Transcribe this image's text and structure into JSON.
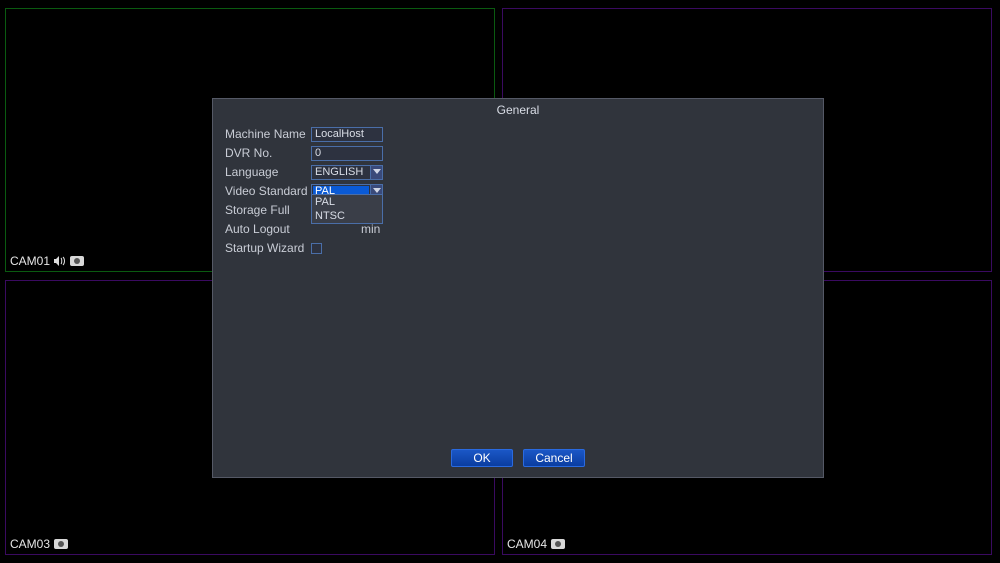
{
  "cameras": {
    "tl": {
      "label": "CAM01",
      "audio": true,
      "rec": true,
      "selected": true
    },
    "tr": {
      "label": "",
      "audio": false,
      "rec": false
    },
    "bl": {
      "label": "CAM03",
      "audio": false,
      "rec": true
    },
    "br": {
      "label": "CAM04",
      "audio": false,
      "rec": true
    }
  },
  "dialog": {
    "title": "General",
    "labels": {
      "machine_name": "Machine Name",
      "dvr_no": "DVR No.",
      "language": "Language",
      "video_standard": "Video Standard",
      "storage_full": "Storage Full",
      "auto_logout": "Auto Logout",
      "auto_logout_suffix": "min",
      "startup_wizard": "Startup Wizard"
    },
    "values": {
      "machine_name": "LocalHost",
      "dvr_no": "0",
      "language": "ENGLISH",
      "video_standard": "PAL"
    },
    "video_standard_options": [
      "PAL",
      "NTSC"
    ],
    "buttons": {
      "ok": "OK",
      "cancel": "Cancel"
    }
  }
}
